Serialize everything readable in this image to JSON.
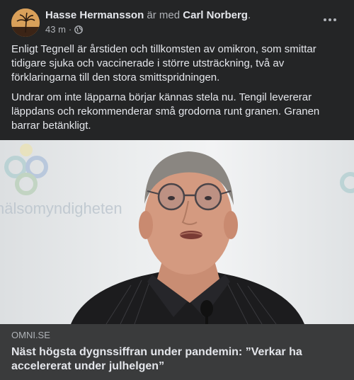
{
  "post": {
    "author": "Hasse Hermansson",
    "with_text": "är med",
    "tagged": "Carl Norberg",
    "period": ".",
    "time": "43 m",
    "separator": "·",
    "privacy_icon": "globe-icon",
    "more_icon": "more-horizontal-icon",
    "paragraphs": [
      "Enligt Tegnell är årstiden och tillkomsten av omikron, som smittar tidigare sjuka och vaccinerade i större utsträckning, två av förklaringarna till den stora smittspridningen.",
      "Undrar om inte läpparna börjar kännas stela nu. Tengil levererar läppdans och rekommenderar små grodorna runt granen. Granen barrar betänkligt."
    ]
  },
  "link_preview": {
    "domain": "OMNI.SE",
    "headline": "Näst högsta dygnssiffran under pandemin: ”Verkar ha accelererat under julhelgen”",
    "background_logo_text": "hälsomyndigheten"
  },
  "colors": {
    "card_bg": "#242526",
    "footer_bg": "#3a3b3c",
    "primary_text": "#e4e6eb",
    "secondary_text": "#b0b3b8"
  }
}
